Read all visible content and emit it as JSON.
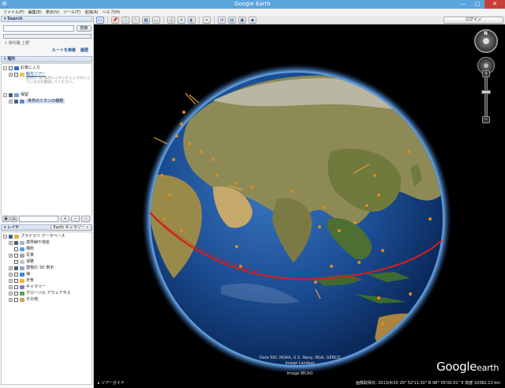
{
  "window": {
    "title": "Google Earth",
    "buttons": [
      "—",
      "□",
      "✕"
    ]
  },
  "menu": [
    "ファイル(F)",
    "編集(E)",
    "表示(V)",
    "ツール(T)",
    "追加(A)",
    "ヘルプ(H)"
  ],
  "toolbar": {
    "icons": [
      "sidebar-toggle-icon",
      "placemark-icon",
      "polygon-icon",
      "path-icon",
      "overlay-icon",
      "record-tour-icon",
      "history-icon",
      "sun-icon",
      "planet-icon",
      "ruler-icon",
      "email-icon",
      "print-icon",
      "save-image-icon",
      "maps-icon"
    ],
    "login_label": "ログイン"
  },
  "search": {
    "header": "Search",
    "input_value": "",
    "button_label": "検索",
    "history": "単科職 上野",
    "route_link": "ルートを検索",
    "history_link": "履歴"
  },
  "places": {
    "header": "場所",
    "items": [
      {
        "label": "お気に入り",
        "level": 0,
        "checked": false
      },
      {
        "label": "観光ツアー",
        "level": 1,
        "checked": false,
        "link": true
      },
      {
        "label": "建物の 3D 表示レイヤにチェックが入っているかを確認してください。",
        "level": 2,
        "tip": true
      },
      {
        "label": "保留",
        "level": 0,
        "checked": true
      },
      {
        "label": "世界のミカンの種類",
        "level": 1,
        "checked": true,
        "selected": true
      }
    ]
  },
  "layers": {
    "header": "レイヤ",
    "gallery_label": "Earth ギャラリー »",
    "items": [
      {
        "label": "プライマリ データベース",
        "level": 0
      },
      {
        "label": "境界線や地名",
        "level": 1
      },
      {
        "label": "場所",
        "level": 1
      },
      {
        "label": "写真",
        "level": 1
      },
      {
        "label": "道路",
        "level": 1
      },
      {
        "label": "建物の 3D 表示",
        "level": 1
      },
      {
        "label": "海",
        "level": 1
      },
      {
        "label": "天気",
        "level": 1
      },
      {
        "label": "ギャラリー",
        "level": 1
      },
      {
        "label": "グローバル アウェアネス",
        "level": 1
      },
      {
        "label": "その他",
        "level": 1
      }
    ]
  },
  "map": {
    "credits": [
      "Data SIO, NOAA, U.S. Navy, NGA, GEBCO",
      "Image Landsat",
      "Image IBCAO"
    ],
    "logo_main": "Google",
    "logo_sub": "earth",
    "tour_label": "ツアーガイド",
    "status": "画像取得日: 2013/4/10    20°  52'11.50\" N   96°  05'00.01\" E  高度 10382.13 km"
  },
  "colors": {
    "accent": "#5aa5dd",
    "equator": "#d21f1f",
    "placemark": "#e08a1e"
  }
}
